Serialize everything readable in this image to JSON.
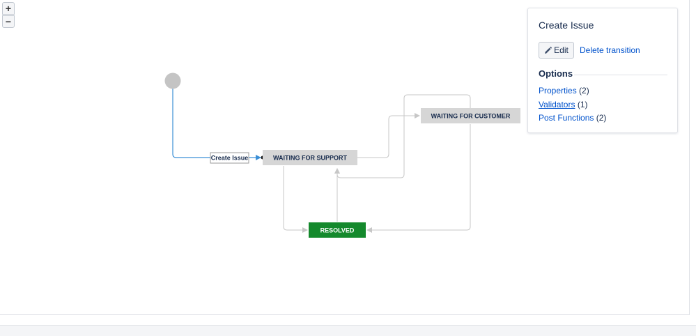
{
  "zoom": {
    "in_label": "+",
    "out_label": "−"
  },
  "diagram": {
    "statuses": [
      {
        "id": "waiting-for-support",
        "label": "WAITING FOR SUPPORT"
      },
      {
        "id": "waiting-for-customer",
        "label": "WAITING FOR CUSTOMER"
      },
      {
        "id": "resolved",
        "label": "RESOLVED"
      }
    ],
    "initial_transition_label": "Create Issue",
    "colors": {
      "status_fill": "#d6d6d6",
      "resolved_fill": "#14892c",
      "selected_line": "#3b8fd6",
      "line": "#c7c7c7",
      "start_node": "#c4c4c4"
    }
  },
  "panel": {
    "title": "Create Issue",
    "edit_label": "Edit",
    "delete_label": "Delete transition",
    "options_heading": "Options",
    "options": [
      {
        "label": "Properties",
        "count": "(2)"
      },
      {
        "label": "Validators",
        "count": "(1)"
      },
      {
        "label": "Post Functions",
        "count": "(2)"
      }
    ]
  }
}
